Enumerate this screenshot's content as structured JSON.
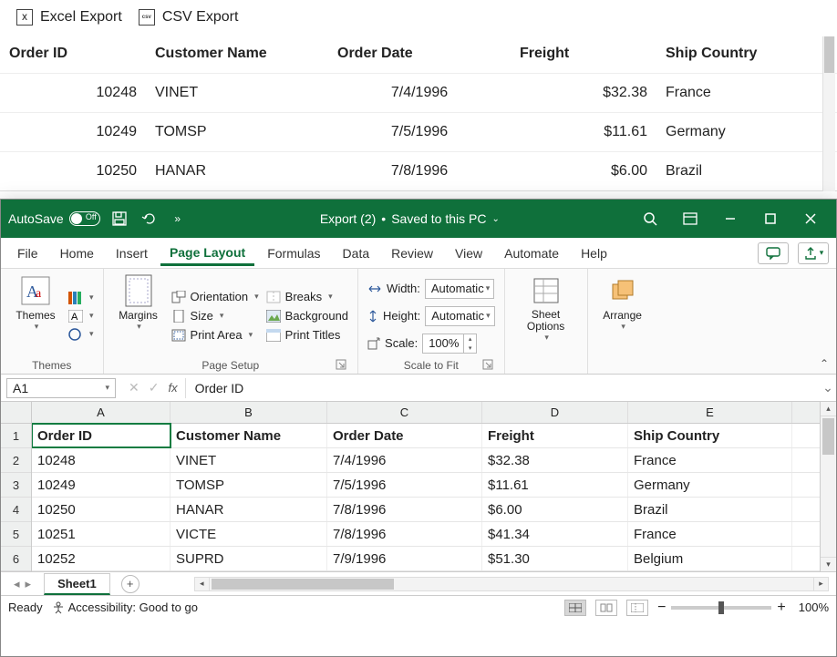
{
  "web": {
    "toolbar": {
      "excel_export": "Excel Export",
      "csv_export": "CSV Export",
      "excel_icon_glyph": "X",
      "csv_icon_glyph": "csv"
    },
    "columns": [
      "Order ID",
      "Customer Name",
      "Order Date",
      "Freight",
      "Ship Country"
    ],
    "rows": [
      {
        "order_id": "10248",
        "customer": "VINET",
        "date": "7/4/1996",
        "freight": "$32.38",
        "country": "France"
      },
      {
        "order_id": "10249",
        "customer": "TOMSP",
        "date": "7/5/1996",
        "freight": "$11.61",
        "country": "Germany"
      },
      {
        "order_id": "10250",
        "customer": "HANAR",
        "date": "7/8/1996",
        "freight": "$6.00",
        "country": "Brazil"
      }
    ]
  },
  "excel": {
    "titlebar": {
      "autosave_label": "AutoSave",
      "autosave_state": "Off",
      "doc_title": "Export (2)",
      "doc_status": "Saved to this PC"
    },
    "tabs": [
      "File",
      "Home",
      "Insert",
      "Page Layout",
      "Formulas",
      "Data",
      "Review",
      "View",
      "Automate",
      "Help"
    ],
    "active_tab": "Page Layout",
    "ribbon": {
      "themes": {
        "label": "Themes",
        "themes_btn": "Themes"
      },
      "page_setup": {
        "label": "Page Setup",
        "margins": "Margins",
        "orientation": "Orientation",
        "size": "Size",
        "print_area": "Print Area",
        "breaks": "Breaks",
        "background": "Background",
        "print_titles": "Print Titles"
      },
      "scale": {
        "label": "Scale to Fit",
        "width_label": "Width:",
        "height_label": "Height:",
        "scale_label": "Scale:",
        "width_value": "Automatic",
        "height_value": "Automatic",
        "scale_value": "100%"
      },
      "sheet_options": {
        "label": "Sheet Options",
        "btn": "Sheet Options"
      },
      "arrange": {
        "label": "Arrange",
        "btn": "Arrange"
      }
    },
    "formula_bar": {
      "name_box": "A1",
      "value": "Order ID"
    },
    "sheet": {
      "col_letters": [
        "A",
        "B",
        "C",
        "D",
        "E"
      ],
      "row_numbers": [
        "1",
        "2",
        "3",
        "4",
        "5",
        "6"
      ],
      "headers": [
        "Order ID",
        "Customer Name",
        "Order Date",
        "Freight",
        "Ship Country"
      ],
      "rows": [
        {
          "a": "10248",
          "b": "VINET",
          "c": "7/4/1996",
          "d": "$32.38",
          "e": "France"
        },
        {
          "a": "10249",
          "b": "TOMSP",
          "c": "7/5/1996",
          "d": "$11.61",
          "e": "Germany"
        },
        {
          "a": "10250",
          "b": "HANAR",
          "c": "7/8/1996",
          "d": "$6.00",
          "e": "Brazil"
        },
        {
          "a": "10251",
          "b": "VICTE",
          "c": "7/8/1996",
          "d": "$41.34",
          "e": "France"
        },
        {
          "a": "10252",
          "b": "SUPRD",
          "c": "7/9/1996",
          "d": "$51.30",
          "e": "Belgium"
        }
      ],
      "tab_name": "Sheet1"
    },
    "status": {
      "ready": "Ready",
      "accessibility": "Accessibility: Good to go",
      "zoom": "100%"
    }
  }
}
